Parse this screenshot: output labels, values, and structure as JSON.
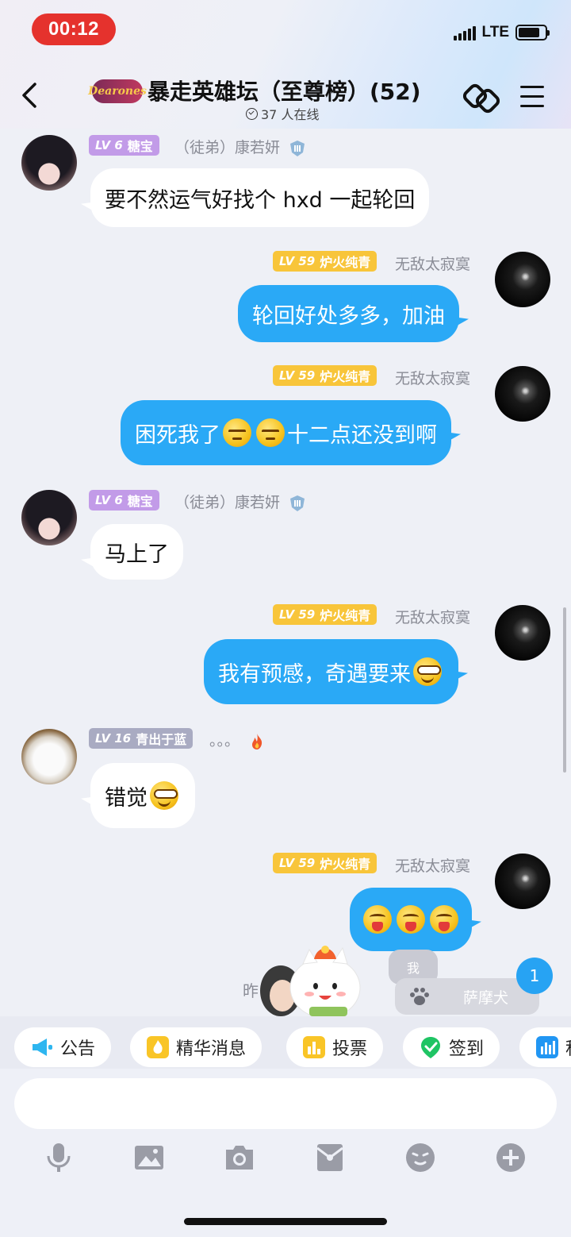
{
  "status_bar": {
    "time": "00:12",
    "network": "LTE"
  },
  "header": {
    "logo_text": "Dearones",
    "title": "暴走英雄坛（至尊榜）(52)",
    "online_text": "37 人在线",
    "icons": [
      "back-arrow-icon",
      "link-icon",
      "menu-icon"
    ]
  },
  "messages": [
    {
      "side": "left",
      "level": "LV 6",
      "title": "糖宝",
      "nickname": "（徒弟）康若妍",
      "text": "要不然运气好找个 hxd 一起轮回"
    },
    {
      "side": "right",
      "level": "LV 59",
      "title": "炉火纯青",
      "nickname": "无敌太寂寞",
      "text": "轮回好处多多，加油"
    },
    {
      "side": "right",
      "level": "LV 59",
      "title": "炉火纯青",
      "nickname": "无敌太寂寞",
      "text_before": "困死我了",
      "text_after": "十二点还没到啊",
      "emojis": [
        "sleepy-emoji",
        "sleepy-emoji"
      ]
    },
    {
      "side": "left",
      "level": "LV 6",
      "title": "糖宝",
      "nickname": "（徒弟）康若妍",
      "text": "马上了"
    },
    {
      "side": "right",
      "level": "LV 59",
      "title": "炉火纯青",
      "nickname": "无敌太寂寞",
      "text": "我有预感，奇遇要来",
      "emojis": [
        "smug-emoji"
      ]
    },
    {
      "side": "left",
      "level": "LV 16",
      "title": "青出于蓝",
      "nickname": "。。。",
      "text": "错觉",
      "emojis": [
        "smug-emoji"
      ]
    },
    {
      "side": "right",
      "level": "LV 59",
      "title": "炉火纯青",
      "nickname": "无敌太寂寞",
      "text": "",
      "emojis": [
        "tongue-emoji",
        "tongue-emoji",
        "tongue-emoji"
      ]
    }
  ],
  "overlays": {
    "me_label": "我",
    "dog_label": "萨摩犬",
    "unread_count": "1",
    "yesterday": "昨"
  },
  "quick_actions": [
    {
      "label": "公告",
      "icon": "megaphone-icon"
    },
    {
      "label": "精华消息",
      "icon": "essence-icon"
    },
    {
      "label": "投票",
      "icon": "vote-icon"
    },
    {
      "label": "签到",
      "icon": "checkin-icon"
    },
    {
      "label": "积",
      "icon": "chart-icon"
    }
  ],
  "input": {
    "placeholder": ""
  },
  "toolbar": [
    "microphone-icon",
    "image-icon",
    "camera-icon",
    "red-packet-icon",
    "emoji-icon",
    "plus-icon"
  ],
  "colors": {
    "bubble_blue": "#2aa9f6",
    "level_purple": "#c29be8",
    "level_gold": "#f8c53a",
    "level_gray": "#a9abc2",
    "time_pill": "#e5322d"
  }
}
